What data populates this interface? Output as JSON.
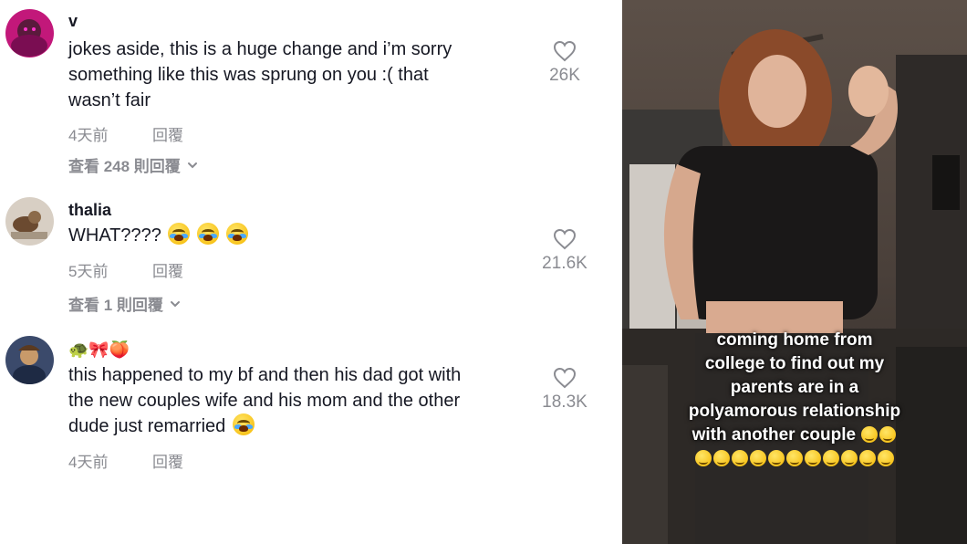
{
  "comments": [
    {
      "username": "v",
      "text_lines": [
        "jokes aside, this is a huge change and i’m sorry",
        "something like this was sprung on you :( that",
        "wasn’t fair"
      ],
      "time": "4天前",
      "reply_label": "回覆",
      "view_replies": "查看 248 則回覆",
      "likes": "26K"
    },
    {
      "username": "thalia",
      "text_lines": [
        "WHAT????"
      ],
      "time": "5天前",
      "reply_label": "回覆",
      "view_replies": "查看 1 則回覆",
      "likes": "21.6K"
    },
    {
      "username": "🐢🎀🍑",
      "text_lines": [
        "this happened to my bf and then his dad got with",
        "the new couples wife and his mom and the other",
        "dude just remarried"
      ],
      "time": "4天前",
      "reply_label": "回覆",
      "likes": "18.3K"
    }
  ],
  "video": {
    "caption_lines": [
      "coming home from",
      "college to find out my",
      "parents are in a",
      "polyamorous relationship",
      "with another couple"
    ]
  },
  "icons": {
    "like": "heart-outline-icon",
    "expand": "chevron-down-icon",
    "emoji": "loudly-crying-face-icon"
  },
  "colors": {
    "text": "#161823",
    "secondary": "#8a8b91"
  }
}
